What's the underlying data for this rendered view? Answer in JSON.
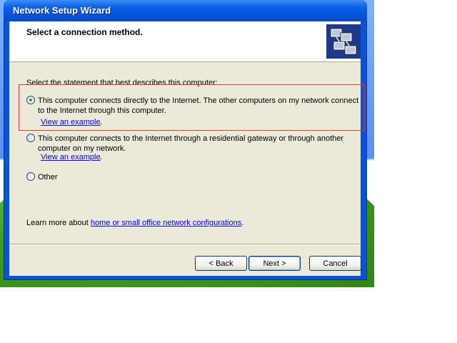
{
  "window": {
    "title": "Network Setup Wizard"
  },
  "header": {
    "title": "Select a connection method."
  },
  "main": {
    "prompt": "Select the statement that best describes this computer:",
    "options": [
      {
        "label": "This computer connects directly to the Internet. The other computers on my network connect to the Internet through this computer.",
        "checked": true,
        "link": "View an example",
        "link_suffix": "."
      },
      {
        "label": "This computer connects to the Internet through a residential gateway or through another computer on my network.",
        "checked": false,
        "link": "View an example",
        "link_suffix": "."
      },
      {
        "label": "Other",
        "checked": false
      }
    ],
    "learn_more": {
      "prefix": "Learn more about ",
      "link": "home or small office network configurations",
      "suffix": "."
    }
  },
  "buttons": {
    "back": "< Back",
    "next": "Next >",
    "cancel": "Cancel"
  },
  "icons": {
    "header": "network-computers-icon"
  },
  "colors": {
    "title_bar": "#0a5fe6",
    "dialog_background": "#ece9d8",
    "link": "#0000ee",
    "highlight_box": "#d03b3b"
  }
}
